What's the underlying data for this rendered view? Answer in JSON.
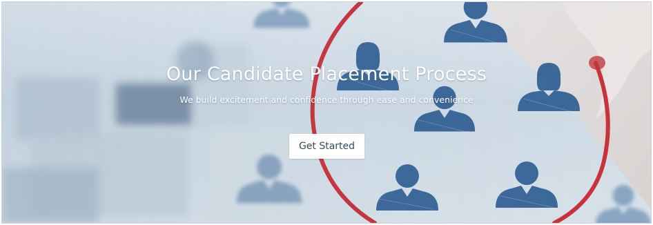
{
  "hero": {
    "title": "Our Candidate Placement Process",
    "subtitle": "We build excitement and confidence through ease and convenience",
    "cta_label": "Get Started"
  },
  "colors": {
    "accent_red": "#c8323a",
    "person_blue": "#2d5d93",
    "text_white": "#ffffff",
    "button_text": "#3a4b5c"
  },
  "icons": [
    "person-male-icon",
    "person-female-icon",
    "selection-circle",
    "hand-image"
  ]
}
